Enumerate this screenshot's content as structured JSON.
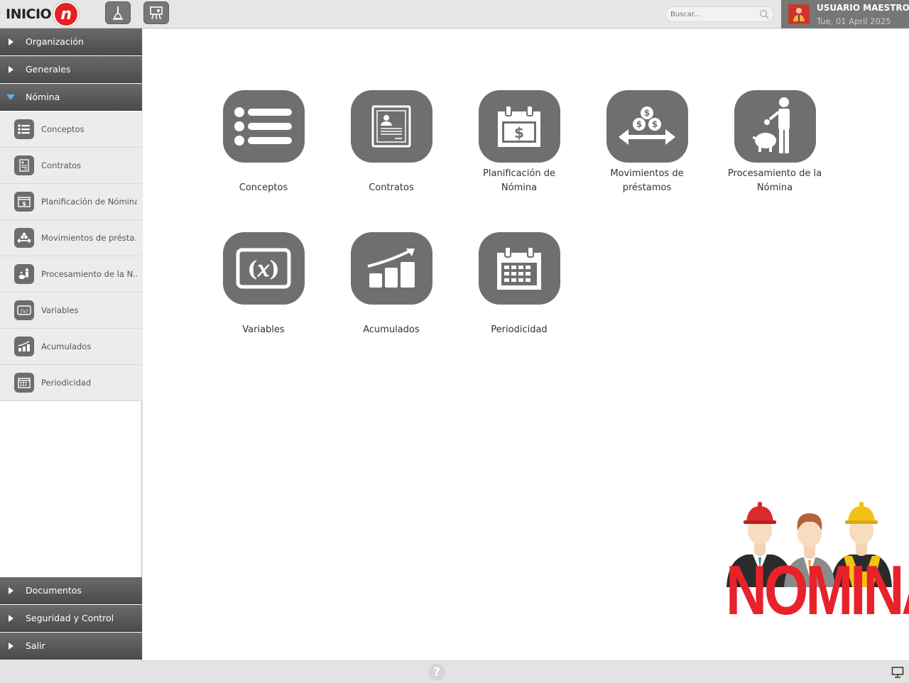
{
  "header": {
    "logo_text": "INICIO",
    "logo_mark": "n",
    "toolbar_icons": [
      "broom-icon",
      "presenter-icon"
    ],
    "search_placeholder": "Buscar...",
    "user_name": "USUARIO MAESTRO",
    "date": "Tue, 01 April 2025"
  },
  "sidebar": {
    "sections_top": [
      {
        "label": "Organización",
        "expanded": false
      },
      {
        "label": "Generales",
        "expanded": false
      },
      {
        "label": "Nómina",
        "expanded": true
      }
    ],
    "items": [
      {
        "label": "Conceptos",
        "icon": "list-icon"
      },
      {
        "label": "Contratos",
        "icon": "contract-icon"
      },
      {
        "label": "Planificación de Nómina",
        "icon": "calendar-dollar-icon"
      },
      {
        "label": "Movimientos de présta...",
        "icon": "money-transfer-icon"
      },
      {
        "label": "Procesamiento de la N...",
        "icon": "piggy-bank-icon"
      },
      {
        "label": "Variables",
        "icon": "variable-icon"
      },
      {
        "label": "Acumulados",
        "icon": "growth-chart-icon"
      },
      {
        "label": "Periodicidad",
        "icon": "calendar-icon"
      }
    ],
    "sections_bottom": [
      {
        "label": "Documentos"
      },
      {
        "label": "Seguridad y Control"
      },
      {
        "label": "Salir"
      }
    ]
  },
  "main": {
    "tiles": [
      {
        "label": "Conceptos",
        "icon": "list-icon"
      },
      {
        "label": "Contratos",
        "icon": "contract-icon"
      },
      {
        "label": "Planificación de\nNómina",
        "icon": "calendar-dollar-icon"
      },
      {
        "label": "Movimientos de\npréstamos",
        "icon": "money-transfer-icon"
      },
      {
        "label": "Procesamiento de la\nNómina",
        "icon": "piggy-bank-icon"
      },
      {
        "label": "Variables",
        "icon": "variable-icon"
      },
      {
        "label": "Acumulados",
        "icon": "growth-chart-icon"
      },
      {
        "label": "Periodicidad",
        "icon": "calendar-icon"
      }
    ],
    "brand_word": "NOMINA"
  },
  "footer": {
    "help_glyph": "?",
    "icons": [
      "help-icon",
      "monitor-icon"
    ]
  },
  "colors": {
    "accent_red": "#e8222a",
    "tile_gray": "#6f6f6f",
    "selected_arrow": "#5ab0e6"
  }
}
